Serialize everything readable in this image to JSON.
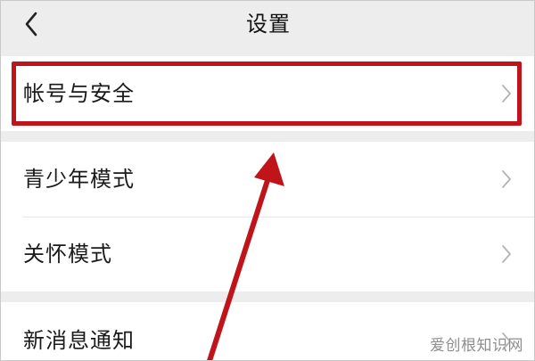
{
  "header": {
    "title": "设置"
  },
  "groups": [
    {
      "items": [
        {
          "label": "帐号与安全"
        }
      ]
    },
    {
      "items": [
        {
          "label": "青少年模式"
        },
        {
          "label": "关怀模式"
        }
      ]
    },
    {
      "items": [
        {
          "label": "新消息通知"
        }
      ]
    }
  ],
  "watermark": "爱创根知识网",
  "colors": {
    "annotation_red": "#c0141b",
    "background": "#ededed",
    "card": "#ffffff"
  },
  "icons": {
    "back": "chevron-left-icon",
    "row_arrow": "chevron-right-icon"
  }
}
